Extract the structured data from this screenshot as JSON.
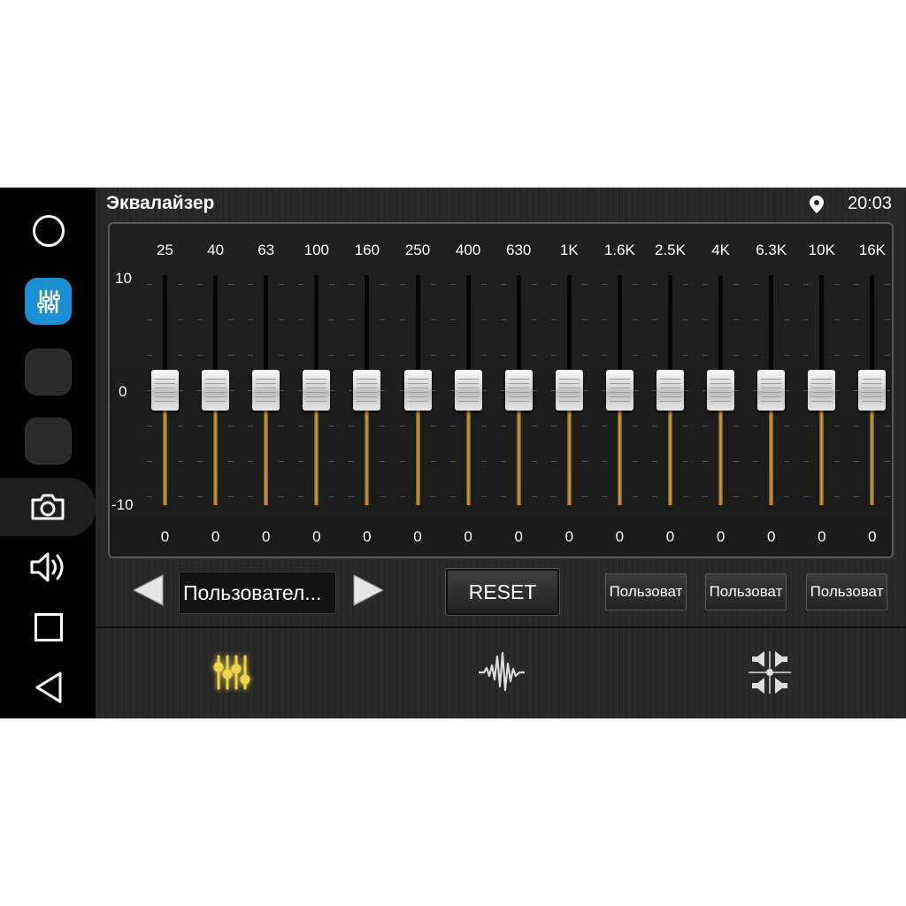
{
  "app": {
    "title": "Эквалайзер"
  },
  "status": {
    "time": "20:03"
  },
  "equalizer": {
    "scale": {
      "max": "10",
      "mid": "0",
      "min": "-10"
    },
    "range": [
      -10,
      10
    ],
    "bands": [
      {
        "freq": "25",
        "value": "0"
      },
      {
        "freq": "40",
        "value": "0"
      },
      {
        "freq": "63",
        "value": "0"
      },
      {
        "freq": "100",
        "value": "0"
      },
      {
        "freq": "160",
        "value": "0"
      },
      {
        "freq": "250",
        "value": "0"
      },
      {
        "freq": "400",
        "value": "0"
      },
      {
        "freq": "630",
        "value": "0"
      },
      {
        "freq": "1K",
        "value": "0"
      },
      {
        "freq": "1.6K",
        "value": "0"
      },
      {
        "freq": "2.5K",
        "value": "0"
      },
      {
        "freq": "4K",
        "value": "0"
      },
      {
        "freq": "6.3K",
        "value": "0"
      },
      {
        "freq": "10K",
        "value": "0"
      },
      {
        "freq": "16K",
        "value": "0"
      }
    ]
  },
  "controls": {
    "preset_name": "Пользовател...",
    "reset_label": "RESET",
    "user_presets": [
      "Пользоват",
      "Пользоват",
      "Пользоват"
    ]
  },
  "colors": {
    "accent_blue": "#1a8fd6",
    "slider_gold": "#d9a441",
    "active_tab": "#e6c220"
  },
  "icons": {
    "nav": [
      "home-icon",
      "equalizer-app-icon",
      "camera-icon",
      "volume-icon",
      "recents-icon",
      "back-icon"
    ],
    "tabs": [
      "equalizer-tab-icon",
      "sound-wave-icon",
      "balance-icon"
    ]
  }
}
